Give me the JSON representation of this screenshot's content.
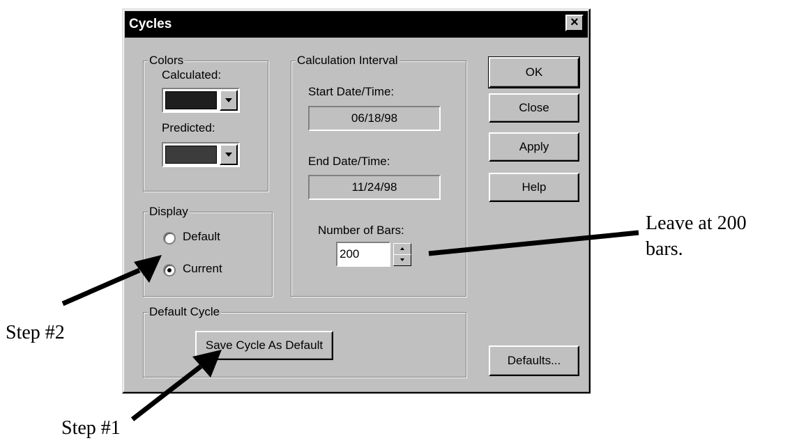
{
  "window": {
    "title": "Cycles",
    "close_label": "×"
  },
  "colors_group": {
    "legend": "Colors",
    "calculated_label": "Calculated:",
    "calculated_color": "#1e1e1e",
    "predicted_label": "Predicted:",
    "predicted_color": "#3c3c3c"
  },
  "display_group": {
    "legend": "Display",
    "options": [
      {
        "label": "Default",
        "selected": false
      },
      {
        "label": "Current",
        "selected": true
      }
    ]
  },
  "interval_group": {
    "legend": "Calculation Interval",
    "start_label": "Start Date/Time:",
    "start_value": "06/18/98",
    "end_label": "End Date/Time:",
    "end_value": "11/24/98",
    "bars_label": "Number of Bars:",
    "bars_value": "200"
  },
  "default_cycle_group": {
    "legend": "Default Cycle",
    "save_button": "Save Cycle As Default"
  },
  "buttons": {
    "ok": "OK",
    "close": "Close",
    "apply": "Apply",
    "help": "Help",
    "defaults": "Defaults..."
  },
  "annotations": {
    "bars_note_line1": "Leave at 200",
    "bars_note_line2": "bars.",
    "step2": "Step #2",
    "step1": "Step #1"
  }
}
